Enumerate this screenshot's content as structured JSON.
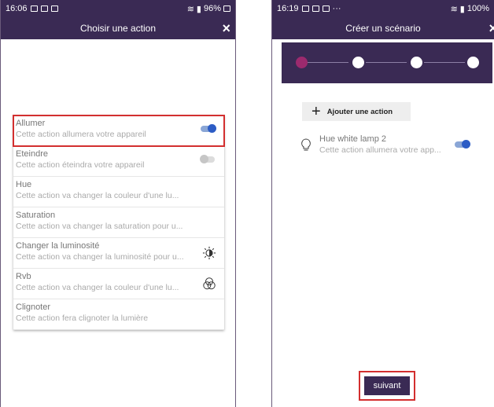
{
  "left": {
    "status": {
      "time": "16:06",
      "battery": "96%"
    },
    "title": "Choisir une action",
    "close_icon": "×",
    "actions": [
      {
        "name": "Allumer",
        "desc": "Cette action allumera votre appareil",
        "toggle": "on"
      },
      {
        "name": "Eteindre",
        "desc": "Cette action éteindra votre appareil",
        "toggle": "off"
      },
      {
        "name": "Hue",
        "desc": "Cette action va changer la couleur d'une lu..."
      },
      {
        "name": "Saturation",
        "desc": "Cette action va changer la saturation pour u..."
      },
      {
        "name": "Changer la luminosité",
        "desc": "Cette action va changer la luminosité pour u...",
        "icon": "brightness-icon"
      },
      {
        "name": "Rvb",
        "desc": "Cette action va changer la couleur d'une lu...",
        "icon": "rgb-circles-icon"
      },
      {
        "name": "Clignoter",
        "desc": "Cette action fera clignoter la lumière"
      }
    ]
  },
  "right": {
    "status": {
      "time": "16:19",
      "battery": "100%"
    },
    "title": "Créer un scénario",
    "close_icon": "×",
    "stepper": {
      "total_steps": 4,
      "active_step": 1
    },
    "add_action_label": "Ajouter une action",
    "add_icon": "+",
    "action": {
      "name": "Hue white lamp 2",
      "desc": "Cette action allumera votre app...",
      "toggle": "on"
    },
    "next_label": "suivant"
  },
  "colors": {
    "header": "#3a2a54",
    "accent_step": "#9c2a6e",
    "toggle_on": "#2c5cc5",
    "highlight": "#d32f2f"
  }
}
